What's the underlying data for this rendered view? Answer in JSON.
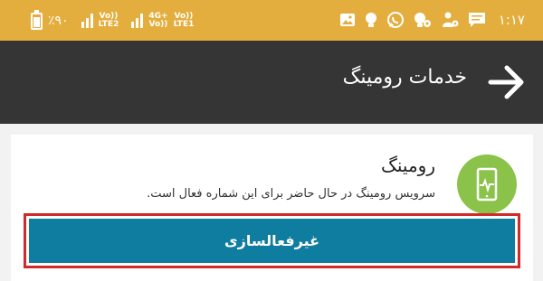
{
  "status_bar": {
    "battery_percent": "٪۹۰",
    "network_1": {
      "top": "Vo))",
      "bottom": "LTE2"
    },
    "network_2": {
      "top": "4G+",
      "bottom": "Vo))"
    },
    "network_3": {
      "top": "Vo))",
      "bottom": "LTE1"
    },
    "time": "۱:۱۷",
    "icons": [
      "image-icon",
      "bulb-icon",
      "whatsapp-icon",
      "bulb-gear-icon",
      "person-gear-icon",
      "message-icon"
    ],
    "background_color": "#e3ae3d"
  },
  "header": {
    "title": "خدمات رومینگ",
    "back_icon": "arrow-right-icon",
    "background_color": "#353535"
  },
  "card": {
    "title": "رومینگ",
    "description": "سرویس رومینگ در حال حاضر برای این شماره فعال است.",
    "icon": "phone-pulse-icon",
    "icon_color": "#8bc34a",
    "button_label": "غیرفعالسازی",
    "button_color": "#0f7d9f",
    "highlight_color": "#d12a2a"
  }
}
